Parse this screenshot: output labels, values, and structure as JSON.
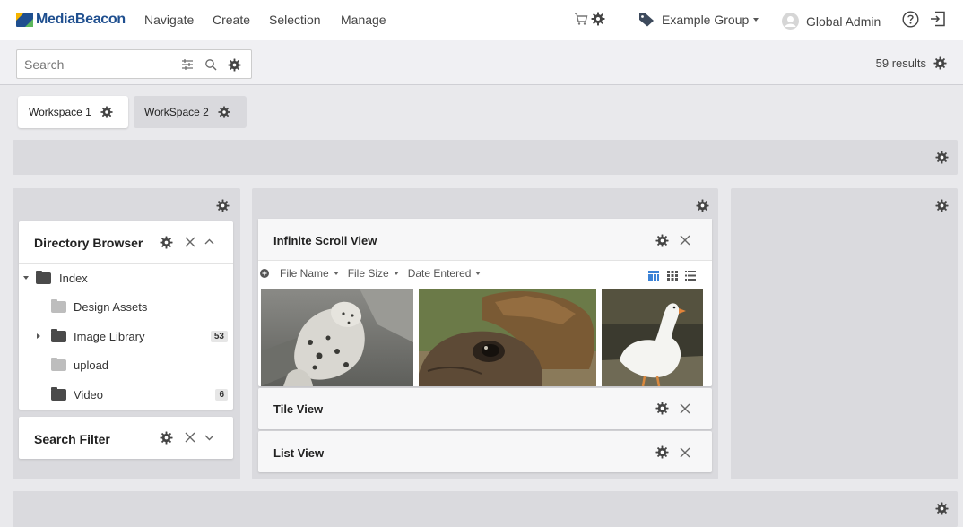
{
  "app": {
    "logo_text": "MediaBeacon",
    "nav": [
      "Navigate",
      "Create",
      "Selection",
      "Manage"
    ],
    "group": "Example Group",
    "user": "Global Admin"
  },
  "search": {
    "placeholder": "Search",
    "results_label": "59 results"
  },
  "workspaces": [
    {
      "label": "Workspace 1",
      "active": true
    },
    {
      "label": "WorkSpace 2",
      "active": false
    }
  ],
  "directory_browser": {
    "title": "Directory Browser",
    "items": [
      {
        "label": "Index",
        "expanded": true
      },
      {
        "label": "Design Assets"
      },
      {
        "label": "Image Library",
        "count": "53"
      },
      {
        "label": "upload"
      },
      {
        "label": "Video",
        "count": "6"
      }
    ]
  },
  "search_filter": {
    "title": "Search Filter"
  },
  "infinite_scroll": {
    "title": "Infinite Scroll View",
    "sort_fields": [
      "File Name",
      "File Size",
      "Date Entered"
    ],
    "thumbnails": [
      "snow-leopard",
      "tortoise",
      "white-goose"
    ]
  },
  "tile_view": {
    "title": "Tile View"
  },
  "list_view": {
    "title": "List View"
  },
  "colors": {
    "brand": "#1f4f8f",
    "accent_blue": "#3b82d6",
    "panel_bg": "#dadade"
  }
}
